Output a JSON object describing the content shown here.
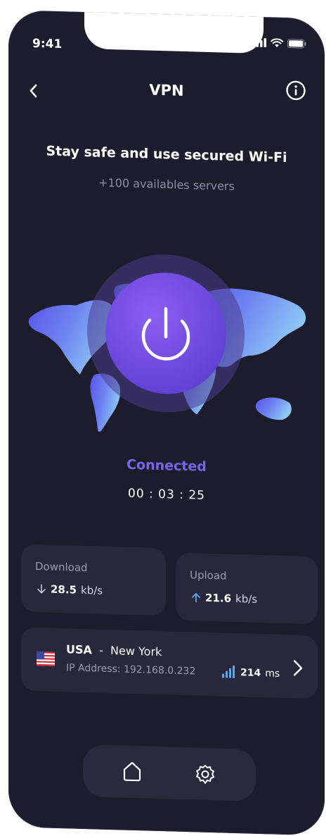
{
  "status_bar": {
    "time": "9:41"
  },
  "header": {
    "title": "VPN"
  },
  "hero": {
    "headline": "Stay safe and use secured Wi-Fi",
    "subline": "+100 availables servers"
  },
  "connection": {
    "status": "Connected",
    "timer": "00 : 03 : 25"
  },
  "download": {
    "label": "Download",
    "value": "28.5",
    "unit": "kb/s"
  },
  "upload": {
    "label": "Upload",
    "value": "21.6",
    "unit": "kb/s"
  },
  "server": {
    "country": "USA",
    "separator": "-",
    "city": "New York",
    "ip_label": "IP Address:",
    "ip": "192.168.0.232",
    "ping_value": "214",
    "ping_unit": "ms"
  },
  "colors": {
    "background": "#1d1c2d",
    "card": "#28273c",
    "accent": "#7a64e8",
    "upload_arrow": "#5aa8f0"
  },
  "icons": [
    "back-arrow-icon",
    "info-icon",
    "power-icon",
    "download-arrow-icon",
    "upload-arrow-icon",
    "usa-flag-icon",
    "signal-icon",
    "chevron-right-icon",
    "home-icon",
    "settings-icon"
  ]
}
